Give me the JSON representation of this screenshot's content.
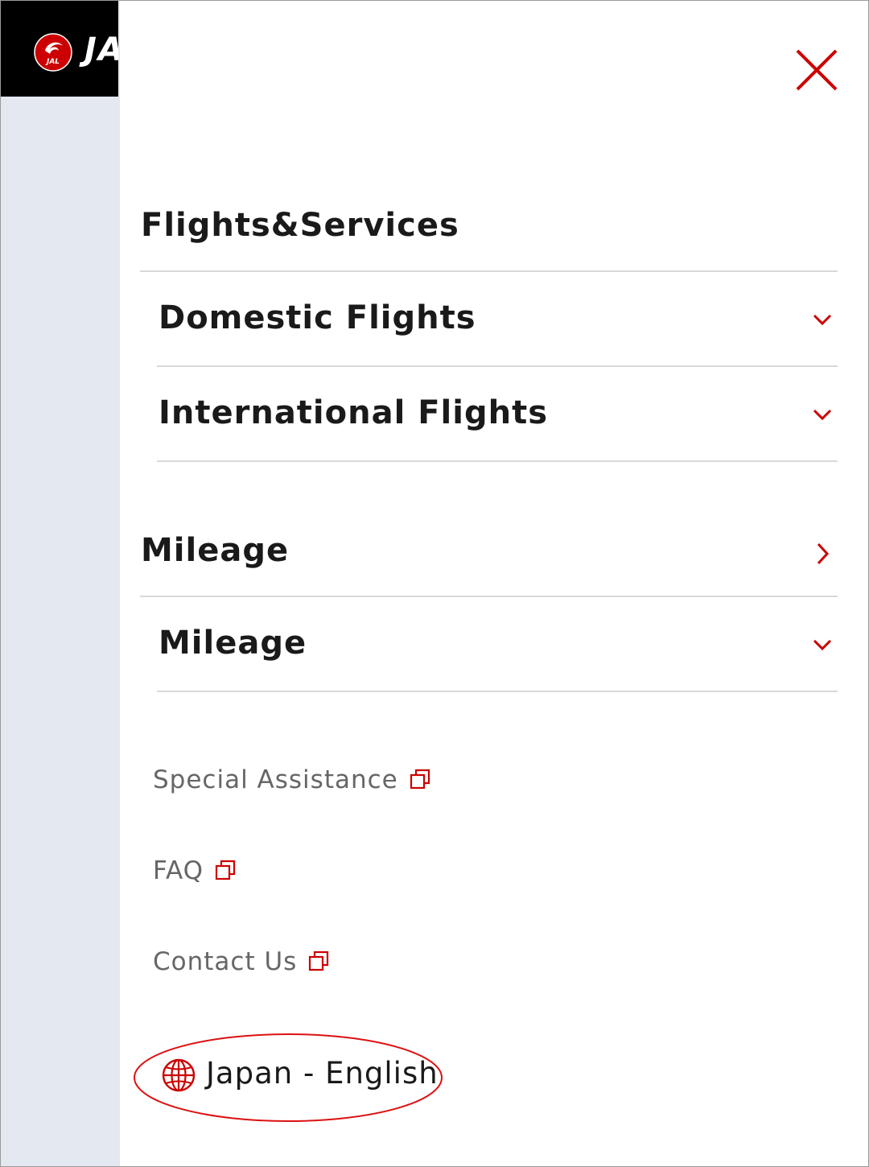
{
  "header": {
    "logo_wordmark": "JAL",
    "emblem_text": "JAL",
    "close_icon": "close-icon",
    "accent_color": "#cc0000"
  },
  "sections": [
    {
      "title": "Flights&Services",
      "items": [
        {
          "label": "Domestic Flights",
          "icon": "chevron-down-icon"
        },
        {
          "label": "International Flights",
          "icon": "chevron-down-icon"
        }
      ]
    },
    {
      "title": "Mileage",
      "title_icon": "chevron-right-icon",
      "items": [
        {
          "label": "Mileage",
          "icon": "chevron-down-icon"
        }
      ]
    }
  ],
  "links": [
    {
      "label": "Special Assistance",
      "icon": "external-link-icon"
    },
    {
      "label": "FAQ",
      "icon": "external-link-icon"
    },
    {
      "label": "Contact Us",
      "icon": "external-link-icon"
    }
  ],
  "language": {
    "label": "Japan - English",
    "icon": "globe-icon"
  }
}
